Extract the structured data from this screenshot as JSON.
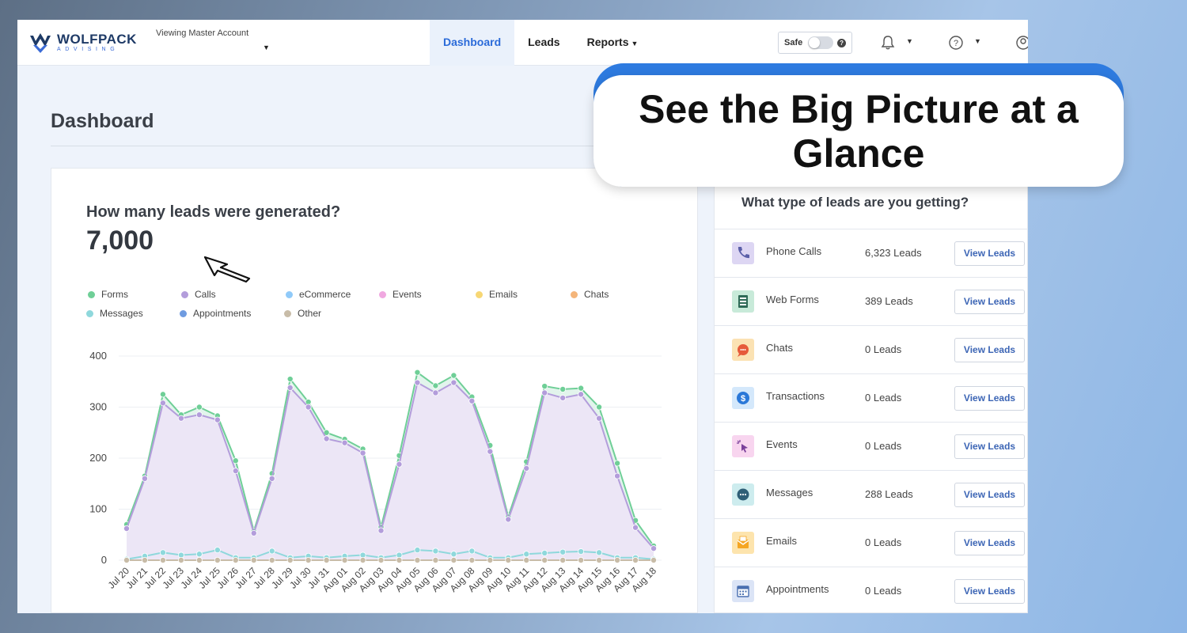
{
  "header": {
    "logo_word": "WOLFPACK",
    "logo_sub": "ADVISING",
    "account_label": "Viewing Master Account",
    "nav": [
      {
        "label": "Dashboard",
        "active": true
      },
      {
        "label": "Leads",
        "active": false
      },
      {
        "label": "Reports",
        "active": false,
        "dropdown": true
      }
    ],
    "safe_label": "Safe",
    "icons": [
      "bell-icon",
      "help-icon",
      "user-icon"
    ]
  },
  "page": {
    "title": "Dashboard"
  },
  "chart_card": {
    "question": "How many leads were generated?",
    "total": "7,000"
  },
  "chart_data": {
    "type": "area",
    "legend_placement": "top",
    "legend": [
      {
        "name": "Forms",
        "color": "#6fcf97"
      },
      {
        "name": "Calls",
        "color": "#b39ddb"
      },
      {
        "name": "eCommerce",
        "color": "#90caf9"
      },
      {
        "name": "Events",
        "color": "#f0a8e0"
      },
      {
        "name": "Emails",
        "color": "#f7d774"
      },
      {
        "name": "Chats",
        "color": "#f4b57a"
      },
      {
        "name": "Messages",
        "color": "#8fd8dc"
      },
      {
        "name": "Appointments",
        "color": "#6f9be0"
      },
      {
        "name": "Other",
        "color": "#c8bca8"
      }
    ],
    "x": [
      "Jul 20",
      "Jul 21",
      "Jul 22",
      "Jul 23",
      "Jul 24",
      "Jul 25",
      "Jul 26",
      "Jul 27",
      "Jul 28",
      "Jul 29",
      "Jul 30",
      "Jul 31",
      "Aug 01",
      "Aug 02",
      "Aug 03",
      "Aug 04",
      "Aug 05",
      "Aug 06",
      "Aug 07",
      "Aug 08",
      "Aug 09",
      "Aug 10",
      "Aug 11",
      "Aug 12",
      "Aug 13",
      "Aug 14",
      "Aug 15",
      "Aug 16",
      "Aug 17",
      "Aug 18"
    ],
    "ylim": [
      0,
      400
    ],
    "yticks": [
      0,
      100,
      200,
      300,
      400
    ],
    "grid": true,
    "series": [
      {
        "name": "Forms",
        "color": "#6fcf97",
        "values": [
          70,
          165,
          325,
          285,
          300,
          283,
          195,
          57,
          170,
          355,
          310,
          250,
          237,
          218,
          65,
          205,
          368,
          342,
          362,
          320,
          225,
          85,
          193,
          341,
          335,
          337,
          300,
          190,
          78,
          28
        ]
      },
      {
        "name": "Calls",
        "color": "#b39ddb",
        "values": [
          62,
          160,
          308,
          278,
          285,
          275,
          175,
          53,
          160,
          338,
          300,
          238,
          230,
          210,
          58,
          188,
          348,
          328,
          348,
          312,
          213,
          80,
          180,
          328,
          318,
          325,
          278,
          165,
          64,
          23
        ]
      },
      {
        "name": "Messages",
        "color": "#8fd8dc",
        "values": [
          2,
          8,
          15,
          10,
          12,
          20,
          5,
          5,
          18,
          5,
          8,
          5,
          8,
          10,
          5,
          10,
          20,
          18,
          12,
          18,
          5,
          5,
          12,
          14,
          16,
          17,
          15,
          5,
          5,
          2
        ]
      },
      {
        "name": "Other",
        "color": "#c8bca8",
        "values": [
          0,
          0,
          0,
          0,
          0,
          0,
          0,
          0,
          0,
          0,
          0,
          0,
          0,
          0,
          0,
          0,
          0,
          0,
          0,
          0,
          0,
          0,
          0,
          0,
          0,
          0,
          0,
          0,
          0,
          0
        ]
      }
    ]
  },
  "leads_card": {
    "title": "What type of leads are you getting?",
    "button_label": "View Leads",
    "rows": [
      {
        "name": "Phone Calls",
        "count": "6,323 Leads",
        "icon": "phone-icon",
        "bg": "#ddd6f3",
        "fg": "#5b5fa8"
      },
      {
        "name": "Web Forms",
        "count": "389 Leads",
        "icon": "form-icon",
        "bg": "#c8ead9",
        "fg": "#2f6b57"
      },
      {
        "name": "Chats",
        "count": "0 Leads",
        "icon": "chat-icon",
        "bg": "#fbe2b3",
        "fg": "#e65a3a"
      },
      {
        "name": "Transactions",
        "count": "0 Leads",
        "icon": "dollar-icon",
        "bg": "#d4e8fb",
        "fg": "#2a78d8"
      },
      {
        "name": "Events",
        "count": "0 Leads",
        "icon": "cursor-click-icon",
        "bg": "#f8d5ef",
        "fg": "#7a3f9a"
      },
      {
        "name": "Messages",
        "count": "288 Leads",
        "icon": "message-icon",
        "bg": "#cdecee",
        "fg": "#2f5f77"
      },
      {
        "name": "Emails",
        "count": "0 Leads",
        "icon": "email-icon",
        "bg": "#fde4ad",
        "fg": "#f5a623"
      },
      {
        "name": "Appointments",
        "count": "0 Leads",
        "icon": "calendar-icon",
        "bg": "#dbe4f6",
        "fg": "#4a6fb0"
      }
    ]
  },
  "callout": {
    "text": "See the Big Picture at a Glance"
  }
}
